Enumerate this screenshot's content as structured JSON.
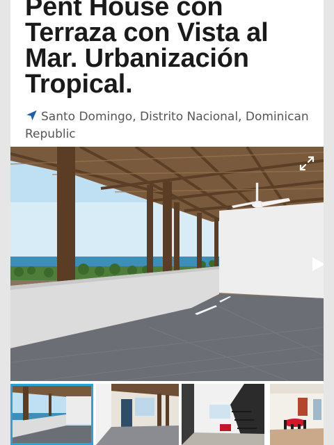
{
  "listing": {
    "title": "Pent House con Terraza con Vista al Mar. Urbanización Tropical.",
    "location": "Santo Domingo, Distrito Nacional, Dominican Republic"
  },
  "icons": {
    "location": "location-arrow-icon",
    "expand": "expand-icon",
    "next": "play-next-icon"
  },
  "colors": {
    "accent": "#2aa3d8",
    "location_icon": "#1e5faa",
    "title": "#1a1a1a"
  },
  "gallery": {
    "photo_count_visible": 4,
    "active_index": 0
  }
}
